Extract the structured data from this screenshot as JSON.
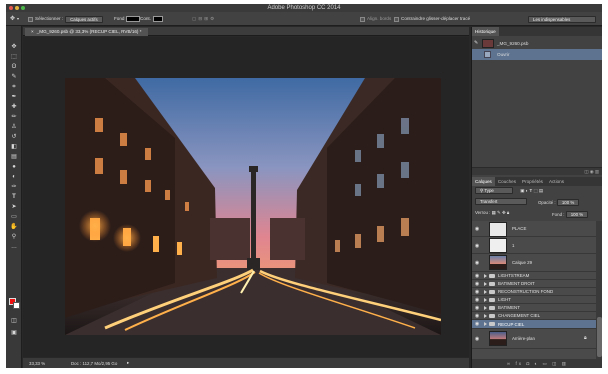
{
  "window": {
    "title": "Adobe Photoshop CC 2014"
  },
  "options_bar": {
    "select_label": "Sélectionner :",
    "select_value": "Calques actifs",
    "fond_label": "Fond",
    "cont_label": "Cont.",
    "align_label": "Align. bords",
    "constrain_label": "Contraindre glisser-déplacer tracé",
    "workspace_value": "Les indispensables"
  },
  "document": {
    "tab_label": "_MG_9260.psb @ 33,3% (RECUP CIEL, RVB/16) *"
  },
  "status_bar": {
    "zoom": "33,33 %",
    "doc_info": "Doc : 112,7 Mo/2,95 Go"
  },
  "history": {
    "tab_label": "Historique",
    "snapshot": "_MG_9260.psb",
    "states": [
      {
        "label": "Ouvrir"
      }
    ]
  },
  "layers_panel": {
    "tabs": [
      "Calques",
      "Couches",
      "Propriétés",
      "Actions"
    ],
    "filter_value": "Type",
    "blend_mode": "Transfert",
    "opacity_label": "Opacité :",
    "opacity_value": "100 %",
    "lock_label": "Verrou :",
    "fill_label": "Fond :",
    "fill_value": "100 %",
    "layers": [
      {
        "name": "PLACE",
        "kind": "pixel"
      },
      {
        "name": "1",
        "kind": "pixel"
      },
      {
        "name": "Calque 29",
        "kind": "image"
      },
      {
        "name": "LIGHTSTREAM",
        "kind": "group"
      },
      {
        "name": "BATIMENT DROIT",
        "kind": "group"
      },
      {
        "name": "RECONSTRUCTION FOND",
        "kind": "group"
      },
      {
        "name": "LIGHT",
        "kind": "group"
      },
      {
        "name": "BATIMENT",
        "kind": "group"
      },
      {
        "name": "CHANGEMENT CIEL",
        "kind": "group"
      },
      {
        "name": "RECUP CIEL",
        "kind": "group",
        "selected": true
      },
      {
        "name": "Arrière-plan",
        "kind": "background"
      }
    ]
  },
  "colors": {
    "foreground": "#e11111",
    "background": "#ffffff",
    "selection": "#5d7390"
  },
  "tool_icons": [
    "move-icon",
    "marquee-icon",
    "lasso-icon",
    "quick-select-icon",
    "crop-icon",
    "eyedropper-icon",
    "healing-icon",
    "brush-icon",
    "stamp-icon",
    "history-brush-icon",
    "eraser-icon",
    "gradient-icon",
    "blur-icon",
    "dodge-icon",
    "pen-icon",
    "type-icon",
    "path-select-icon",
    "shape-icon",
    "hand-icon",
    "zoom-icon"
  ]
}
